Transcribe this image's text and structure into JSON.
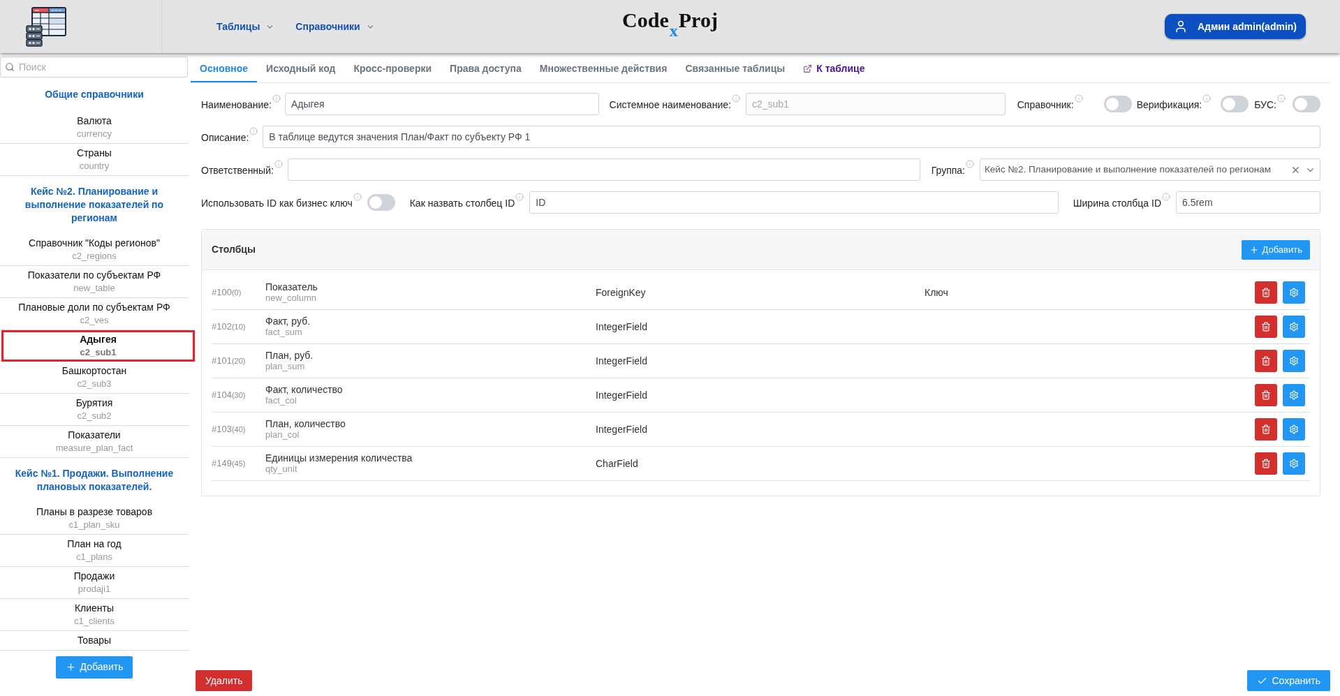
{
  "header": {
    "nav": [
      {
        "label": "Таблицы"
      },
      {
        "label": "Справочники"
      }
    ],
    "brand": {
      "left": "Code",
      "mark": "x",
      "right": "Proj"
    },
    "user_button": "Админ admin(admin)"
  },
  "sidebar": {
    "search": {
      "placeholder": "Поиск"
    },
    "groups": [
      {
        "title": "Общие справочники",
        "items": [
          {
            "name": "Валюта",
            "code": "currency",
            "selected": false
          },
          {
            "name": "Страны",
            "code": "country",
            "selected": false
          }
        ]
      },
      {
        "title": "Кейс №2. Планирование и выполнение показателей по регионам",
        "items": [
          {
            "name": "Справочник \"Коды регионов\"",
            "code": "c2_regions",
            "selected": false
          },
          {
            "name": "Показатели по субъектам РФ",
            "code": "new_table",
            "selected": false
          },
          {
            "name": "Плановые доли по субъектам РФ",
            "code": "c2_ves",
            "selected": false
          },
          {
            "name": "Адыгея",
            "code": "c2_sub1",
            "selected": true
          },
          {
            "name": "Башкортостан",
            "code": "c2_sub3",
            "selected": false
          },
          {
            "name": "Бурятия",
            "code": "c2_sub2",
            "selected": false
          },
          {
            "name": "Показатели",
            "code": "measure_plan_fact",
            "selected": false
          }
        ]
      },
      {
        "title": "Кейс №1. Продажи. Выполнение плановых показателей.",
        "items": [
          {
            "name": "Планы в разрезе товаров",
            "code": "c1_plan_sku",
            "selected": false
          },
          {
            "name": "План на год",
            "code": "c1_plans",
            "selected": false
          },
          {
            "name": "Продажи",
            "code": "prodaji1",
            "selected": false
          },
          {
            "name": "Клиенты",
            "code": "c1_clients",
            "selected": false
          },
          {
            "name": "Товары",
            "selected": false
          }
        ]
      }
    ],
    "add_button": "Добавить"
  },
  "tabs": [
    {
      "label": "Основное",
      "kind": "tab",
      "selected": true
    },
    {
      "label": "Исходный код",
      "kind": "tab",
      "selected": false
    },
    {
      "label": "Кросс-проверки",
      "kind": "tab",
      "selected": false
    },
    {
      "label": "Права доступа",
      "kind": "tab",
      "selected": false
    },
    {
      "label": "Множественные действия",
      "kind": "tab",
      "selected": false
    },
    {
      "label": "Связанные таблицы",
      "kind": "tab",
      "selected": false
    },
    {
      "label": "К таблице",
      "kind": "link",
      "selected": false
    }
  ],
  "form": {
    "name": {
      "label": "Наименование:",
      "value": "Адыгея",
      "disabled": false
    },
    "system_name": {
      "label": "Системное наименование:",
      "value": "c2_sub1",
      "disabled": true
    },
    "flags": [
      {
        "label": "Справочник:",
        "on": false
      },
      {
        "label": "Верификация:",
        "on": false
      },
      {
        "label": "БУС:",
        "on": false
      }
    ],
    "description": {
      "label": "Описание:",
      "value": "В таблице ведутся значения План/Факт по субъекту РФ 1"
    },
    "owner": {
      "label": "Ответственный:"
    },
    "group": {
      "label": "Группа:",
      "value": "Кейс №2. Планирование и выполнение показателей по регионам"
    },
    "business_key": {
      "label": "Использовать ID как бизнес ключ",
      "on": false
    },
    "id_column_name": {
      "label": "Как назвать столбец ID",
      "value": "ID"
    },
    "id_column_width": {
      "label": "Ширина столбца ID",
      "value": "6.5rem"
    }
  },
  "columns_panel": {
    "title": "Столбцы",
    "add_button": "Добавить",
    "rows": [
      {
        "id": "#100",
        "order": "(0)",
        "name": "Показатель",
        "code": "new_column",
        "type": "ForeignKey",
        "column_4": "Ключ"
      },
      {
        "id": "#102",
        "order": "(10)",
        "name": "Факт, руб.",
        "code": "fact_sum",
        "type": "IntegerField"
      },
      {
        "id": "#101",
        "order": "(20)",
        "name": "План, руб.",
        "code": "plan_sum",
        "type": "IntegerField"
      },
      {
        "id": "#104",
        "order": "(30)",
        "name": "Факт, количество",
        "code": "fact_col",
        "type": "IntegerField"
      },
      {
        "id": "#103",
        "order": "(40)",
        "name": "План, количество",
        "code": "plan_col",
        "type": "IntegerField"
      },
      {
        "id": "#149",
        "order": "(45)",
        "name": "Единицы измерения количества",
        "code": "qty_unit",
        "type": "CharField"
      }
    ]
  },
  "footer": {
    "delete_button": "Удалить",
    "save_button": "Сохранить"
  }
}
